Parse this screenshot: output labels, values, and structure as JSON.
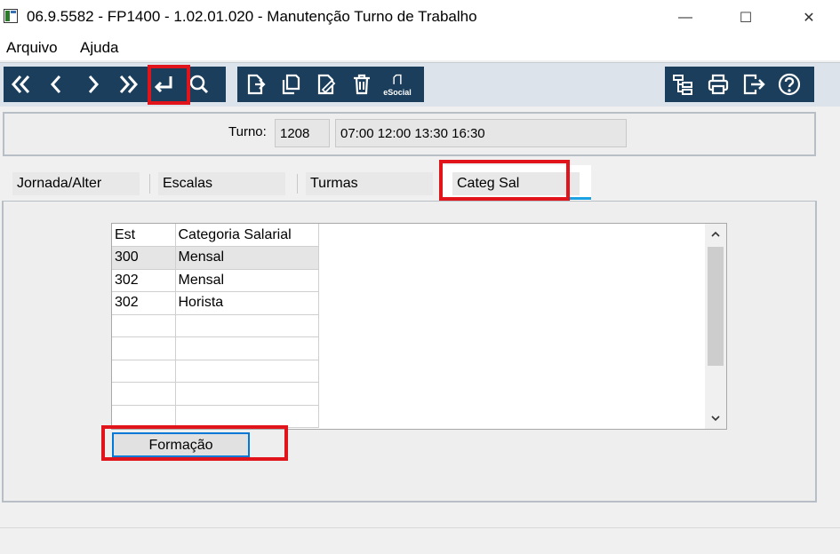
{
  "window": {
    "title": "06.9.5582 - FP1400 - 1.02.01.020 - Manutenção Turno de Trabalho",
    "minimize": "—",
    "maximize": "☐",
    "close": "✕"
  },
  "menu": {
    "items": [
      "Arquivo",
      "Ajuda"
    ]
  },
  "toolbar": {
    "nav_icons": [
      "first-icon",
      "previous-icon",
      "next-icon",
      "last-icon",
      "enter-icon",
      "search-icon"
    ],
    "edit_icons": [
      "new-icon",
      "copy-icon",
      "edit-icon",
      "delete-icon",
      "esocial-icon"
    ],
    "esocial_label": "eSocial",
    "right_icons": [
      "structure-icon",
      "print-icon",
      "exit-icon",
      "help-icon"
    ],
    "accent": "#1b3e5c"
  },
  "header": {
    "turno_label": "Turno:",
    "turno_code": "1208",
    "turno_horario": "07:00 12:00 13:30 16:30"
  },
  "tabs": [
    "Jornada/Alter",
    "Escalas",
    "Turmas",
    "Categ Sal"
  ],
  "active_tab": "Categ Sal",
  "grid": {
    "columns": [
      "Est",
      "Categoria Salarial"
    ],
    "rows": [
      {
        "est": "300",
        "categoria": "Mensal"
      },
      {
        "est": "302",
        "categoria": "Mensal"
      },
      {
        "est": "302",
        "categoria": "Horista"
      },
      {
        "est": "",
        "categoria": ""
      },
      {
        "est": "",
        "categoria": ""
      },
      {
        "est": "",
        "categoria": ""
      },
      {
        "est": "",
        "categoria": ""
      },
      {
        "est": "",
        "categoria": ""
      }
    ]
  },
  "buttons": {
    "formacao": "Formação"
  },
  "annotation_color": "#e0141a"
}
